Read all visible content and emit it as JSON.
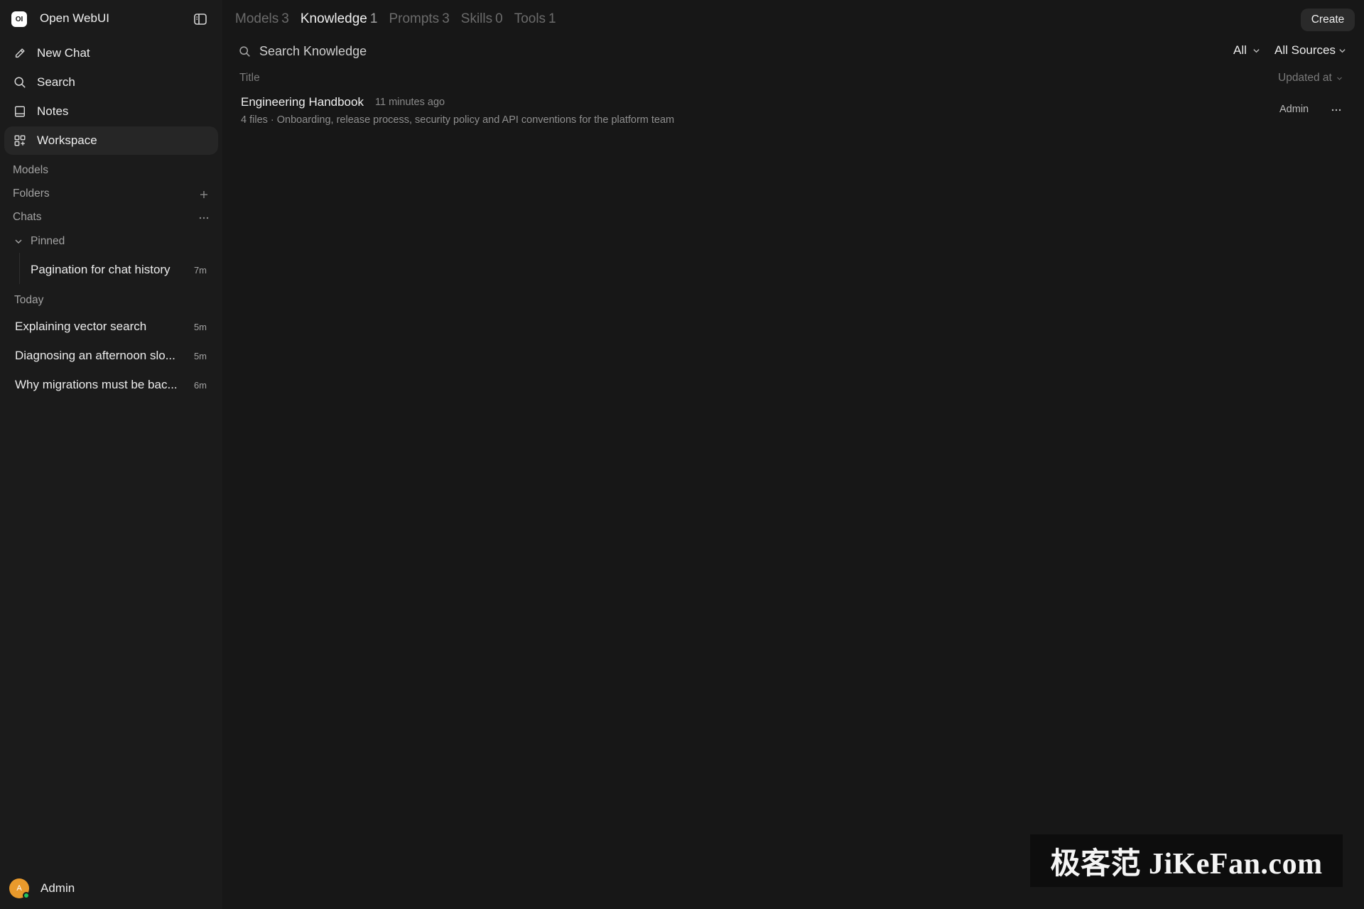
{
  "app": {
    "title": "Open WebUI",
    "logo_text": "OI"
  },
  "sidebar": {
    "nav": [
      {
        "label": "New Chat",
        "icon": "pencil-icon"
      },
      {
        "label": "Search",
        "icon": "search-icon"
      },
      {
        "label": "Notes",
        "icon": "notes-icon"
      },
      {
        "label": "Workspace",
        "icon": "grid-icon",
        "active": true
      }
    ],
    "sections": {
      "models": "Models",
      "folders": "Folders",
      "chats": "Chats"
    },
    "pinned": {
      "label": "Pinned",
      "items": [
        {
          "title": "Pagination for chat history",
          "time": "7m"
        }
      ]
    },
    "today": {
      "label": "Today",
      "items": [
        {
          "title": "Explaining vector search",
          "time": "5m"
        },
        {
          "title": "Diagnosing an afternoon slo...",
          "time": "5m"
        },
        {
          "title": "Why migrations must be bac...",
          "time": "6m"
        }
      ]
    },
    "user": {
      "name": "Admin",
      "initial": "A",
      "status_color": "#22c55e",
      "avatar_color": "#e99a2c"
    }
  },
  "workspace": {
    "tabs": [
      {
        "label": "Models",
        "count": "3"
      },
      {
        "label": "Knowledge",
        "count": "1",
        "active": true
      },
      {
        "label": "Prompts",
        "count": "3"
      },
      {
        "label": "Skills",
        "count": "0"
      },
      {
        "label": "Tools",
        "count": "1"
      }
    ],
    "create_label": "Create",
    "search": {
      "placeholder": "Search Knowledge",
      "value": ""
    },
    "filters": {
      "scope": "All",
      "sources": "All Sources"
    },
    "columns": {
      "title": "Title",
      "updated": "Updated at"
    },
    "items": [
      {
        "name": "Engineering Handbook",
        "updated": "11 minutes ago",
        "description": "4 files · Onboarding, release process, security policy and API conventions for the platform team",
        "owner": "Admin"
      }
    ]
  },
  "watermark": "极客范 JiKeFan.com",
  "colors": {
    "background": "#171717",
    "sidebar": "#1b1b1b",
    "active_nav": "#262626"
  }
}
